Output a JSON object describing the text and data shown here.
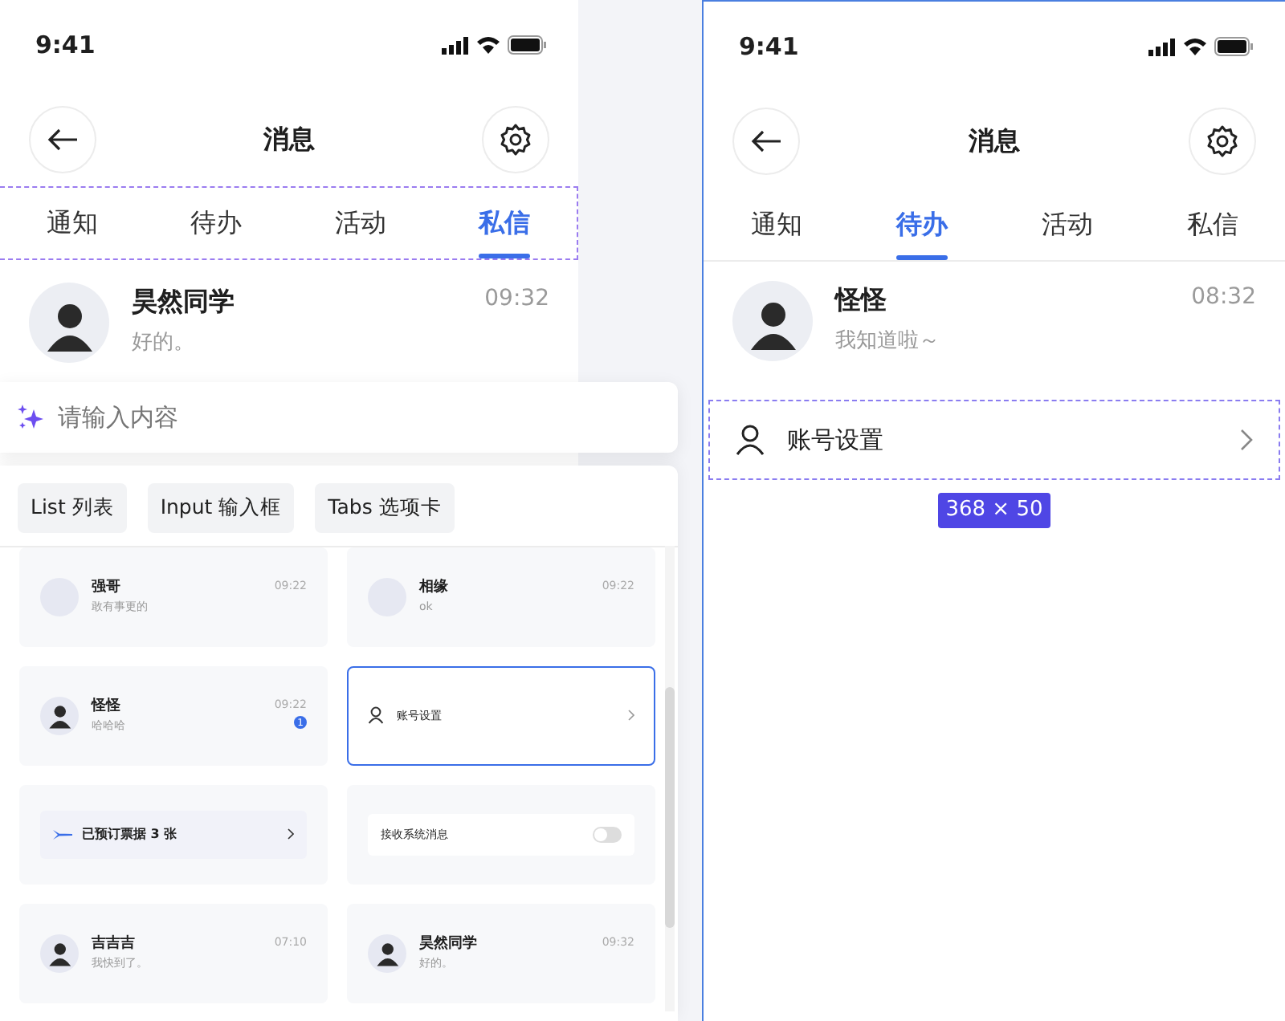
{
  "left_phone": {
    "status_time": "9:41",
    "title": "消息",
    "tabs": [
      {
        "label": "通知",
        "selected": false
      },
      {
        "label": "待办",
        "selected": false
      },
      {
        "label": "活动",
        "selected": false
      },
      {
        "label": "私信",
        "selected": true
      }
    ],
    "messages": [
      {
        "name": "昊然同学",
        "time": "09:32",
        "preview": "好的。",
        "figure": true
      }
    ]
  },
  "prompt_input": {
    "placeholder": "请输入内容"
  },
  "component_tabs": [
    "List 列表",
    "Input 输入框",
    "Tabs 选项卡"
  ],
  "preview_cards": [
    {
      "kind": "message",
      "name": "强哥",
      "time": "09:22",
      "preview": "敢有事更的",
      "figure": false,
      "selected": false
    },
    {
      "kind": "message",
      "name": "相缘",
      "time": "09:22",
      "preview": "ok",
      "figure": false,
      "selected": false
    },
    {
      "kind": "message",
      "name": "怪怪",
      "time": "09:22",
      "preview": "哈哈哈",
      "figure": true,
      "badge": "1",
      "selected": false
    },
    {
      "kind": "setting",
      "label": "账号设置",
      "selected": true
    },
    {
      "kind": "ticket",
      "label": "已预订票据 3 张",
      "selected": false
    },
    {
      "kind": "toggle",
      "label": "接收系统消息",
      "on": false,
      "selected": false
    },
    {
      "kind": "message",
      "name": "吉吉吉",
      "time": "07:10",
      "preview": "我快到了。",
      "figure": true,
      "selected": false
    },
    {
      "kind": "message",
      "name": "昊然同学",
      "time": "09:32",
      "preview": "好的。",
      "figure": true,
      "selected": false
    }
  ],
  "right_phone": {
    "status_time": "9:41",
    "title": "消息",
    "tabs": [
      {
        "label": "通知",
        "selected": false
      },
      {
        "label": "待办",
        "selected": true
      },
      {
        "label": "活动",
        "selected": false
      },
      {
        "label": "私信",
        "selected": false
      }
    ],
    "messages": [
      {
        "name": "怪怪",
        "time": "08:32",
        "preview": "我知道啦～",
        "figure": true
      }
    ],
    "setting_row": {
      "label": "账号设置"
    },
    "size_label": "368 × 50"
  }
}
